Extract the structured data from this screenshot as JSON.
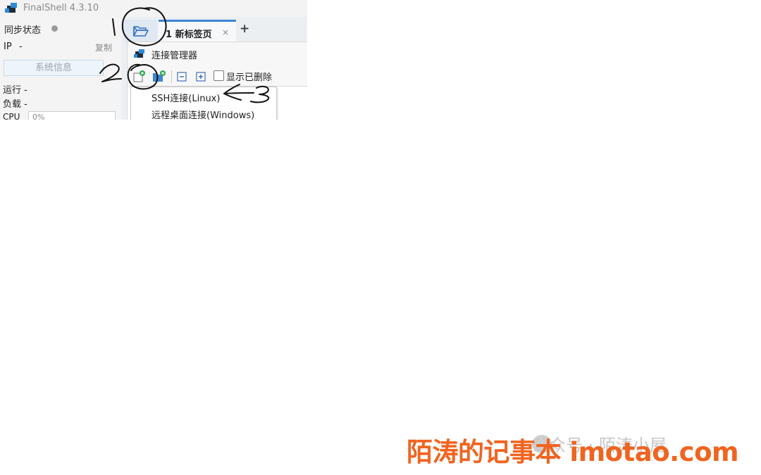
{
  "app": {
    "title": "FinalShell 4.3.10"
  },
  "left_panel": {
    "sync_label": "同步状态",
    "ip_label": "IP",
    "ip_value": "-",
    "copy_label": "复制",
    "sysinfo_label": "系统信息",
    "run_label": "运行 -",
    "load_label": "负载 -",
    "cpu_label": "CPU",
    "cpu_value": "0%"
  },
  "tabs": {
    "items": [
      {
        "label": "1  新标签页"
      }
    ],
    "close_glyph": "×",
    "add_glyph": "+"
  },
  "connection_manager": {
    "title": "连接管理器",
    "show_deleted_label": "显示已删除",
    "show_deleted_checked": false,
    "menu": {
      "items": [
        {
          "label": "SSH连接(Linux)"
        },
        {
          "label": "远程桌面连接(Windows)"
        }
      ]
    }
  },
  "annotations": {
    "marks": [
      "1",
      "2",
      "3"
    ]
  },
  "watermark": {
    "text": "公众号 · 陌涛小屋"
  },
  "brand": {
    "text": "陌涛的记事本 imotao.com",
    "color": "#f06420"
  },
  "icons": [
    "app-logo-icon",
    "folder-open-icon",
    "new-connection-icon",
    "new-folder-icon",
    "collapse-all-icon",
    "expand-all-icon",
    "connection-manager-icon"
  ]
}
